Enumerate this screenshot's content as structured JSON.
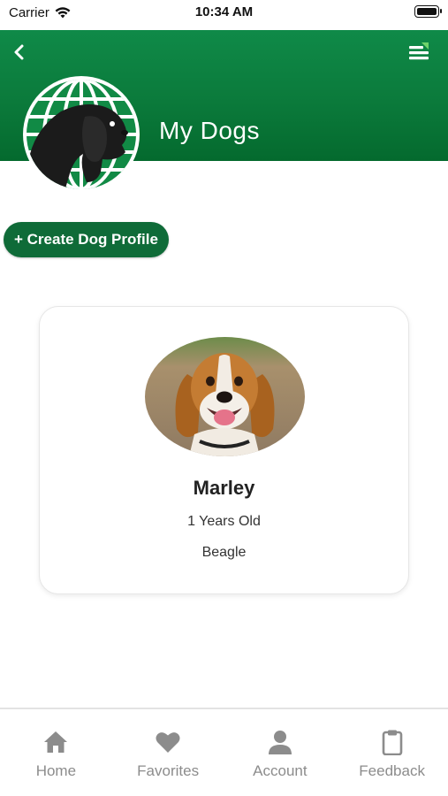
{
  "status_bar": {
    "carrier": "Carrier",
    "time": "10:34 AM"
  },
  "header": {
    "title": "My Dogs",
    "back_icon": "chevron-left-icon",
    "menu_icon": "menu-icon",
    "logo": "globe-dog-logo",
    "colors": {
      "primary": "#0b7a3b",
      "accent": "#6fd36a"
    }
  },
  "actions": {
    "create_label": "+ Create Dog Profile"
  },
  "dogs": [
    {
      "name": "Marley",
      "age": "1 Years Old",
      "breed": "Beagle",
      "photo": "beagle-photo"
    }
  ],
  "bottom_nav": {
    "items": [
      {
        "label": "Home",
        "icon": "home-icon"
      },
      {
        "label": "Favorites",
        "icon": "heart-icon"
      },
      {
        "label": "Account",
        "icon": "user-icon"
      },
      {
        "label": "Feedback",
        "icon": "clipboard-icon"
      }
    ],
    "inactive_color": "#8c8c8c"
  }
}
